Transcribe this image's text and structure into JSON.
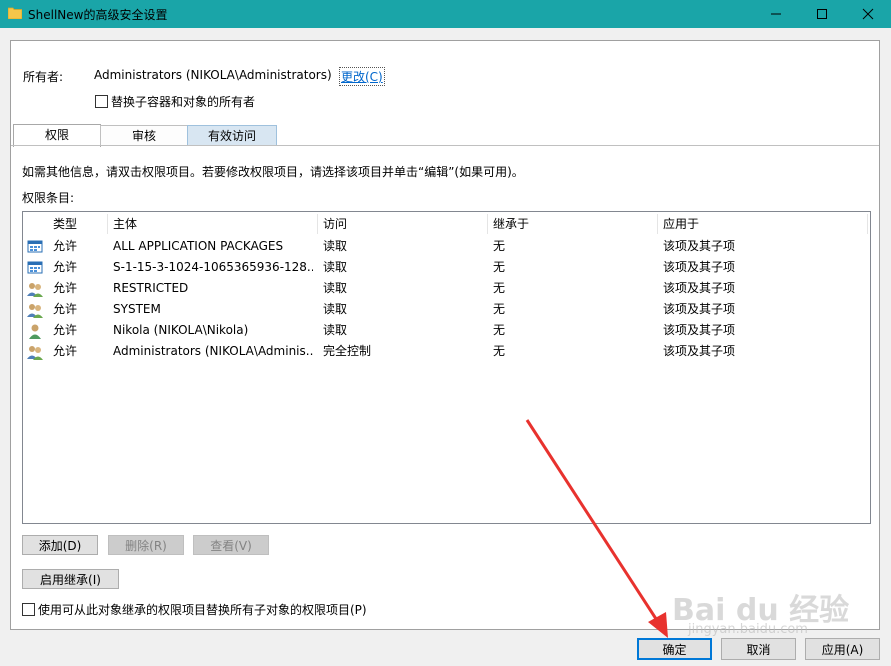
{
  "window": {
    "title": "ShellNew的高级安全设置"
  },
  "owner": {
    "label": "所有者:",
    "value": "Administrators (NIKOLA\\Administrators)",
    "change_link": "更改(C)"
  },
  "replace_owner_checkbox": {
    "label": "替换子容器和对象的所有者",
    "checked": false
  },
  "tabs": [
    {
      "label": "权限",
      "active": true
    },
    {
      "label": "审核",
      "active": false
    },
    {
      "label": "有效访问",
      "active": false
    }
  ],
  "info_text": "如需其他信息，请双击权限项目。若要修改权限项目，请选择该项目并单击“编辑”(如果可用)。",
  "entries_label": "权限条目:",
  "table": {
    "columns": [
      "类型",
      "主体",
      "访问",
      "继承于",
      "应用于"
    ],
    "rows": [
      {
        "icon": "app-package-icon",
        "type": "允许",
        "principal": "ALL APPLICATION PACKAGES",
        "access": "读取",
        "inherited": "无",
        "applies": "该项及其子项"
      },
      {
        "icon": "app-package-icon",
        "type": "允许",
        "principal": "S-1-15-3-1024-1065365936-128...",
        "access": "读取",
        "inherited": "无",
        "applies": "该项及其子项"
      },
      {
        "icon": "group-users-icon",
        "type": "允许",
        "principal": "RESTRICTED",
        "access": "读取",
        "inherited": "无",
        "applies": "该项及其子项"
      },
      {
        "icon": "group-users-icon",
        "type": "允许",
        "principal": "SYSTEM",
        "access": "读取",
        "inherited": "无",
        "applies": "该项及其子项"
      },
      {
        "icon": "single-user-icon",
        "type": "允许",
        "principal": "Nikola (NIKOLA\\Nikola)",
        "access": "读取",
        "inherited": "无",
        "applies": "该项及其子项"
      },
      {
        "icon": "group-users-icon",
        "type": "允许",
        "principal": "Administrators (NIKOLA\\Adminis...",
        "access": "完全控制",
        "inherited": "无",
        "applies": "该项及其子项"
      }
    ]
  },
  "buttons": {
    "add": "添加(D)",
    "remove": "删除(R)",
    "view": "查看(V)",
    "enable_inheritance": "启用继承(I)",
    "ok": "确定",
    "cancel": "取消",
    "apply": "应用(A)"
  },
  "replace_child_checkbox": {
    "label": "使用可从此对象继承的权限项目替换所有子对象的权限项目(P)",
    "checked": false
  },
  "watermark": {
    "brand": "Bai du 经验",
    "url": "jingyan.baidu.com"
  },
  "colors": {
    "titlebar": "#1aa5a8",
    "link": "#0066cc",
    "annotation_arrow": "#e8322e"
  }
}
